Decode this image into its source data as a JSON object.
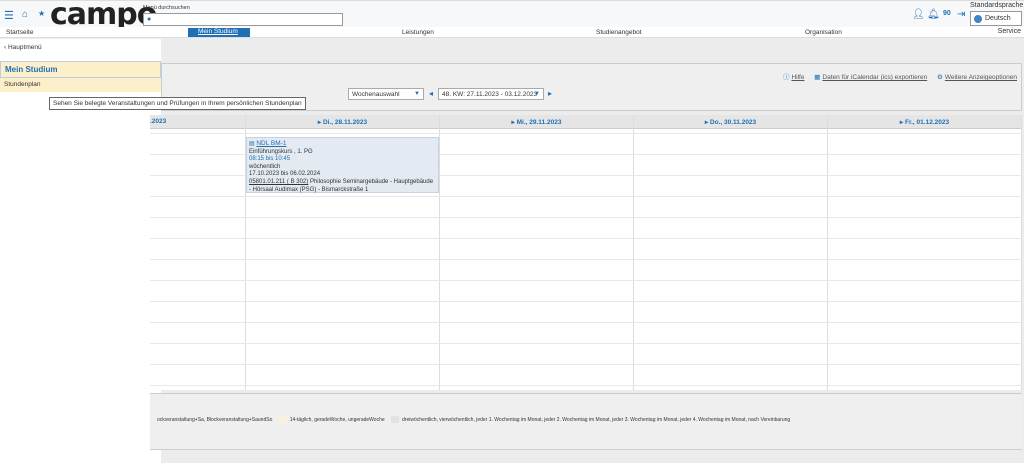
{
  "header": {
    "logo": "campo",
    "search_label": "Menü durchsuchen",
    "search_placeholder": "",
    "notification_count": "90",
    "language_label": "Standardsprache",
    "language": "Deutsch"
  },
  "nav": {
    "items": [
      "Startseite",
      "Mein Studium",
      "Leistungen",
      "Studienangebot",
      "Organisation",
      "Service"
    ],
    "active": "Mein Studium"
  },
  "sidebar": {
    "back": "Hauptmenü",
    "section": "Mein Studium",
    "item": "Stundenplan"
  },
  "tooltip": "Sehen Sie belegte Veranstaltungen und Prüfungen in Ihrem persönlichen Stundenplan",
  "toolbar": {
    "help": "Hilfe",
    "export": "Daten für iCalendar (ics) exportieren",
    "options": "Weitere Anzeigeoptionen",
    "week_mode": "Wochenauswahl",
    "week": "48. KW: 27.11.2023 - 03.12.2023"
  },
  "calendar": {
    "days": [
      ".2023",
      "Di., 28.11.2023",
      "Mi., 29.11.2023",
      "Do., 30.11.2023",
      "Fr., 01.12.2023"
    ],
    "event": {
      "title": "NDL BM-1",
      "type": "Einführungskurs , 1. PG",
      "time": "08:15 bis 10:45",
      "rhythm": "wöchentlich",
      "period": "17.10.2023 bis 06.02.2024",
      "room": "05801.01.211 ( B 302)",
      "building": "Philosophie Seminargebäude - Hauptgebäude - Hörsaal Audimax (PSG) - Bismarckstraße 1"
    }
  },
  "legend": {
    "items": [
      "ockveranstaltung+Sa, Blockveranstaltung+SaundSo",
      "14-täglich, geradeWoche, ungeradeWoche",
      "dreiwöchentlich, vierwöchentlich, jeder 1. Wochentag im Monat, jeder 2. Wochentag im Monat, jeder 3. Wochentag im Monat, jeder 4. Wochentag im Monat, nach Vereinbarung"
    ],
    "colors": [
      "#f7f2d8",
      "#e6e6e6"
    ]
  },
  "colors": {
    "accent": "#1f6fb5",
    "highlight": "#fdefca"
  }
}
